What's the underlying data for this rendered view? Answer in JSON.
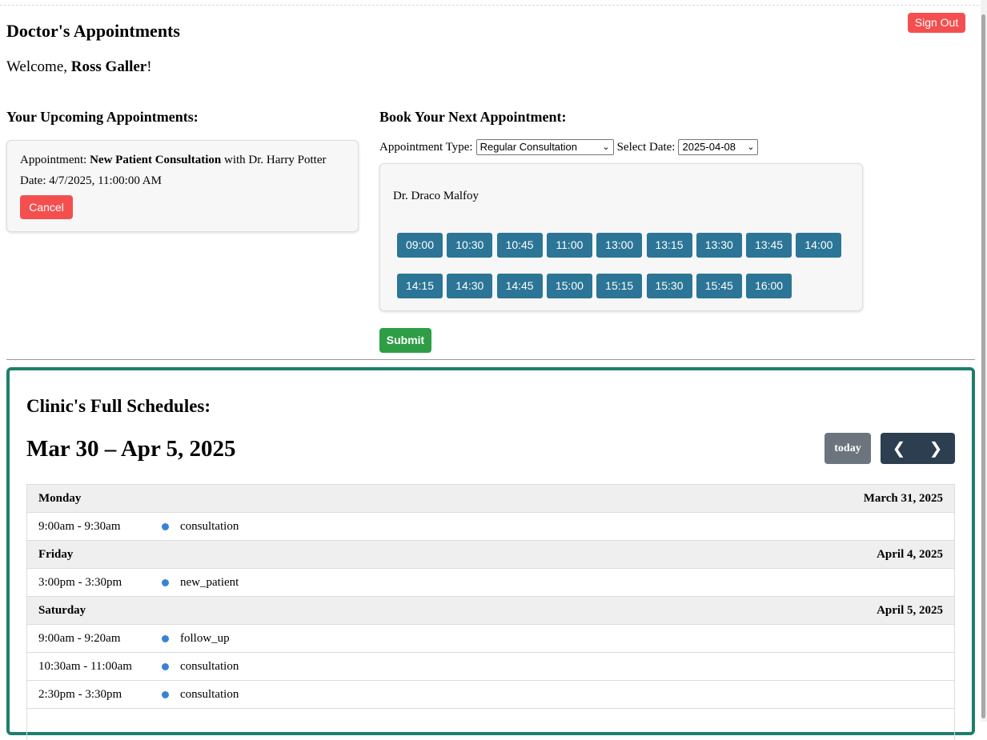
{
  "header": {
    "title": "Doctor's Appointments",
    "welcome_prefix": "Welcome, ",
    "user_name": "Ross Galler",
    "welcome_suffix": "!",
    "signout_label": "Sign Out"
  },
  "upcoming": {
    "heading": "Your Upcoming Appointments:",
    "appointment": {
      "label": "Appointment: ",
      "type": "New Patient Consultation",
      "doctor_text": " with Dr. Harry Potter",
      "date_text": "Date: 4/7/2025, 11:00:00 AM",
      "cancel_label": "Cancel"
    }
  },
  "booking": {
    "heading": "Book Your Next Appointment:",
    "type_label": "Appointment Type:",
    "type_value": "Regular Consultation",
    "date_label": "Select Date:",
    "date_value": "2025-04-08",
    "doctor": "Dr. Draco Malfoy",
    "slots": [
      "09:00",
      "10:30",
      "10:45",
      "11:00",
      "13:00",
      "13:15",
      "13:30",
      "13:45",
      "14:00",
      "14:15",
      "14:30",
      "14:45",
      "15:00",
      "15:15",
      "15:30",
      "15:45",
      "16:00"
    ],
    "submit_label": "Submit"
  },
  "schedule": {
    "heading": "Clinic's Full Schedules:",
    "range": "Mar 30 – Apr 5, 2025",
    "today_label": "today",
    "prev_icon": "chevron-left-icon",
    "next_icon": "chevron-right-icon",
    "event_color": "#3a82d6",
    "days": [
      {
        "name": "Monday",
        "date": "March 31, 2025",
        "events": [
          {
            "time": "9:00am - 9:30am",
            "title": "consultation"
          }
        ]
      },
      {
        "name": "Friday",
        "date": "April 4, 2025",
        "events": [
          {
            "time": "3:00pm - 3:30pm",
            "title": "new_patient"
          }
        ]
      },
      {
        "name": "Saturday",
        "date": "April 5, 2025",
        "events": [
          {
            "time": "9:00am - 9:20am",
            "title": "follow_up"
          },
          {
            "time": "10:30am - 11:00am",
            "title": "consultation"
          },
          {
            "time": "2:30pm - 3:30pm",
            "title": "consultation"
          }
        ]
      }
    ]
  }
}
